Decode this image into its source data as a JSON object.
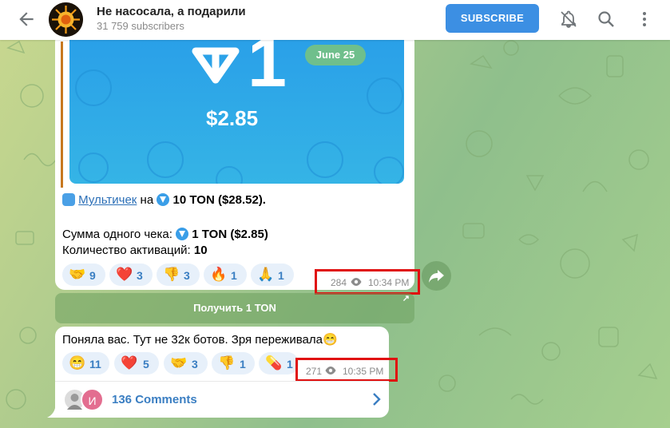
{
  "header": {
    "title": "Не насосала, а подарили",
    "subtitle": "31 759 subscribers",
    "subscribe_label": "SUBSCRIBE",
    "icons": [
      "back-arrow-icon",
      "bell-off-icon",
      "search-icon",
      "more-vertical-icon"
    ]
  },
  "post1": {
    "date_badge": "June 25",
    "image_amount": "1",
    "image_price": "$2.85",
    "line1_link": "Мультичек",
    "line1_mid": "на",
    "line1_amount": "10 TON ($28.52).",
    "line2_label": "Сумма одного чека:",
    "line2_amount": "1 TON ($2.85)",
    "line3_label": "Количество активаций:",
    "line3_value": "10",
    "reactions": [
      {
        "emoji": "🤝",
        "count": "9"
      },
      {
        "emoji": "❤️",
        "count": "3"
      },
      {
        "emoji": "👎",
        "count": "3"
      },
      {
        "emoji": "🔥",
        "count": "1"
      },
      {
        "emoji": "🙏",
        "count": "1"
      }
    ],
    "views": "284",
    "time": "10:34 PM",
    "button_label": "Получить 1 TON",
    "button_arrow": "↗"
  },
  "post2": {
    "text": "Поняла вас. Тут не 32к ботов. Зря переживала😁",
    "reactions": [
      {
        "emoji": "😁",
        "count": "11"
      },
      {
        "emoji": "❤️",
        "count": "5"
      },
      {
        "emoji": "🤝",
        "count": "3"
      },
      {
        "emoji": "👎",
        "count": "1"
      },
      {
        "emoji": "💊",
        "count": "1"
      }
    ],
    "views": "271",
    "time": "10:35 PM",
    "comments_label": "136 Comments",
    "commenter_initial": "И"
  },
  "colors": {
    "accent": "#3c8fe3",
    "highlight_box": "#e01010",
    "reaction_count": "#3a7ec2",
    "quote_bar": "#c7781f"
  }
}
